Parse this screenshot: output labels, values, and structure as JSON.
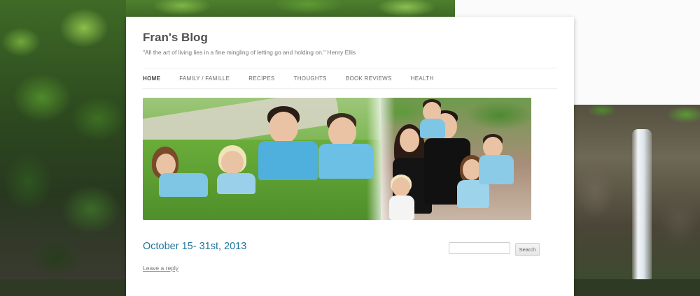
{
  "site": {
    "title": "Fran's Blog",
    "tagline": "\"All the art of living lies in a fine mingling of letting go and holding on.\" Henry Ellis"
  },
  "nav": {
    "items": [
      {
        "label": "HOME",
        "current": true
      },
      {
        "label": "FAMILY / FAMILLE",
        "current": false
      },
      {
        "label": "RECIPES",
        "current": false
      },
      {
        "label": "THOUGHTS",
        "current": false
      },
      {
        "label": "BOOK REVIEWS",
        "current": false
      },
      {
        "label": "HEALTH",
        "current": false
      }
    ]
  },
  "post": {
    "title": "October 15- 31st, 2013",
    "leave_reply": "Leave a reply"
  },
  "search": {
    "placeholder": "",
    "button_label": "Search"
  },
  "colors": {
    "link_blue": "#21759b",
    "title_gray": "#515151",
    "nav_text": "#6a6a6a",
    "page_bg": "#ffffff"
  }
}
